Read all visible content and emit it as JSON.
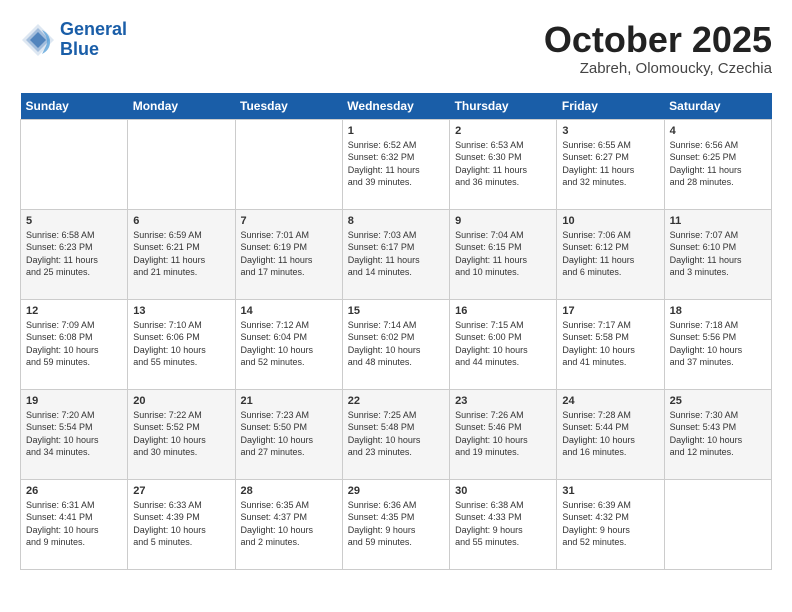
{
  "header": {
    "logo_line1": "General",
    "logo_line2": "Blue",
    "month": "October 2025",
    "location": "Zabreh, Olomoucky, Czechia"
  },
  "days_of_week": [
    "Sunday",
    "Monday",
    "Tuesday",
    "Wednesday",
    "Thursday",
    "Friday",
    "Saturday"
  ],
  "weeks": [
    [
      {
        "day": "",
        "info": ""
      },
      {
        "day": "",
        "info": ""
      },
      {
        "day": "",
        "info": ""
      },
      {
        "day": "1",
        "info": "Sunrise: 6:52 AM\nSunset: 6:32 PM\nDaylight: 11 hours\nand 39 minutes."
      },
      {
        "day": "2",
        "info": "Sunrise: 6:53 AM\nSunset: 6:30 PM\nDaylight: 11 hours\nand 36 minutes."
      },
      {
        "day": "3",
        "info": "Sunrise: 6:55 AM\nSunset: 6:27 PM\nDaylight: 11 hours\nand 32 minutes."
      },
      {
        "day": "4",
        "info": "Sunrise: 6:56 AM\nSunset: 6:25 PM\nDaylight: 11 hours\nand 28 minutes."
      }
    ],
    [
      {
        "day": "5",
        "info": "Sunrise: 6:58 AM\nSunset: 6:23 PM\nDaylight: 11 hours\nand 25 minutes."
      },
      {
        "day": "6",
        "info": "Sunrise: 6:59 AM\nSunset: 6:21 PM\nDaylight: 11 hours\nand 21 minutes."
      },
      {
        "day": "7",
        "info": "Sunrise: 7:01 AM\nSunset: 6:19 PM\nDaylight: 11 hours\nand 17 minutes."
      },
      {
        "day": "8",
        "info": "Sunrise: 7:03 AM\nSunset: 6:17 PM\nDaylight: 11 hours\nand 14 minutes."
      },
      {
        "day": "9",
        "info": "Sunrise: 7:04 AM\nSunset: 6:15 PM\nDaylight: 11 hours\nand 10 minutes."
      },
      {
        "day": "10",
        "info": "Sunrise: 7:06 AM\nSunset: 6:12 PM\nDaylight: 11 hours\nand 6 minutes."
      },
      {
        "day": "11",
        "info": "Sunrise: 7:07 AM\nSunset: 6:10 PM\nDaylight: 11 hours\nand 3 minutes."
      }
    ],
    [
      {
        "day": "12",
        "info": "Sunrise: 7:09 AM\nSunset: 6:08 PM\nDaylight: 10 hours\nand 59 minutes."
      },
      {
        "day": "13",
        "info": "Sunrise: 7:10 AM\nSunset: 6:06 PM\nDaylight: 10 hours\nand 55 minutes."
      },
      {
        "day": "14",
        "info": "Sunrise: 7:12 AM\nSunset: 6:04 PM\nDaylight: 10 hours\nand 52 minutes."
      },
      {
        "day": "15",
        "info": "Sunrise: 7:14 AM\nSunset: 6:02 PM\nDaylight: 10 hours\nand 48 minutes."
      },
      {
        "day": "16",
        "info": "Sunrise: 7:15 AM\nSunset: 6:00 PM\nDaylight: 10 hours\nand 44 minutes."
      },
      {
        "day": "17",
        "info": "Sunrise: 7:17 AM\nSunset: 5:58 PM\nDaylight: 10 hours\nand 41 minutes."
      },
      {
        "day": "18",
        "info": "Sunrise: 7:18 AM\nSunset: 5:56 PM\nDaylight: 10 hours\nand 37 minutes."
      }
    ],
    [
      {
        "day": "19",
        "info": "Sunrise: 7:20 AM\nSunset: 5:54 PM\nDaylight: 10 hours\nand 34 minutes."
      },
      {
        "day": "20",
        "info": "Sunrise: 7:22 AM\nSunset: 5:52 PM\nDaylight: 10 hours\nand 30 minutes."
      },
      {
        "day": "21",
        "info": "Sunrise: 7:23 AM\nSunset: 5:50 PM\nDaylight: 10 hours\nand 27 minutes."
      },
      {
        "day": "22",
        "info": "Sunrise: 7:25 AM\nSunset: 5:48 PM\nDaylight: 10 hours\nand 23 minutes."
      },
      {
        "day": "23",
        "info": "Sunrise: 7:26 AM\nSunset: 5:46 PM\nDaylight: 10 hours\nand 19 minutes."
      },
      {
        "day": "24",
        "info": "Sunrise: 7:28 AM\nSunset: 5:44 PM\nDaylight: 10 hours\nand 16 minutes."
      },
      {
        "day": "25",
        "info": "Sunrise: 7:30 AM\nSunset: 5:43 PM\nDaylight: 10 hours\nand 12 minutes."
      }
    ],
    [
      {
        "day": "26",
        "info": "Sunrise: 6:31 AM\nSunset: 4:41 PM\nDaylight: 10 hours\nand 9 minutes."
      },
      {
        "day": "27",
        "info": "Sunrise: 6:33 AM\nSunset: 4:39 PM\nDaylight: 10 hours\nand 5 minutes."
      },
      {
        "day": "28",
        "info": "Sunrise: 6:35 AM\nSunset: 4:37 PM\nDaylight: 10 hours\nand 2 minutes."
      },
      {
        "day": "29",
        "info": "Sunrise: 6:36 AM\nSunset: 4:35 PM\nDaylight: 9 hours\nand 59 minutes."
      },
      {
        "day": "30",
        "info": "Sunrise: 6:38 AM\nSunset: 4:33 PM\nDaylight: 9 hours\nand 55 minutes."
      },
      {
        "day": "31",
        "info": "Sunrise: 6:39 AM\nSunset: 4:32 PM\nDaylight: 9 hours\nand 52 minutes."
      },
      {
        "day": "",
        "info": ""
      }
    ]
  ]
}
